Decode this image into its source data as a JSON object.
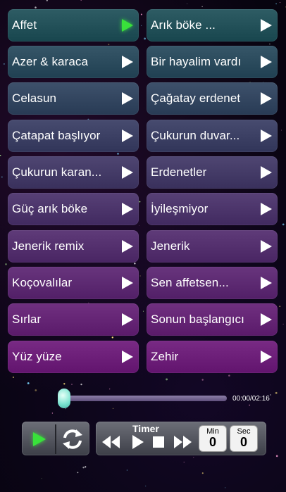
{
  "songs": [
    {
      "label": "Affet",
      "active": true
    },
    {
      "label": "Arık böke ...",
      "active": false
    },
    {
      "label": "Azer & karaca",
      "active": false
    },
    {
      "label": "Bir hayalim vardı",
      "active": false
    },
    {
      "label": "Celasun",
      "active": false
    },
    {
      "label": "Çağatay erdenet",
      "active": false
    },
    {
      "label": "Çatapat başlıyor",
      "active": false
    },
    {
      "label": "Çukurun duvar...",
      "active": false
    },
    {
      "label": "Çukurun karan...",
      "active": false
    },
    {
      "label": "Erdenetler",
      "active": false
    },
    {
      "label": "Güç arık böke",
      "active": false
    },
    {
      "label": "İyileşmiyor",
      "active": false
    },
    {
      "label": "Jenerik remix",
      "active": false
    },
    {
      "label": "Jenerik",
      "active": false
    },
    {
      "label": "Koçovalılar",
      "active": false
    },
    {
      "label": "Sen affetsen...",
      "active": false
    },
    {
      "label": "Sırlar",
      "active": false
    },
    {
      "label": "Sonun başlangıcı",
      "active": false
    },
    {
      "label": "Yüz yüze",
      "active": false
    },
    {
      "label": "Zehir",
      "active": false
    }
  ],
  "player": {
    "time_display": "00:00/02:16",
    "progress": 0,
    "accent_color": "#39e23b"
  },
  "timer": {
    "title": "Timer",
    "min_label": "Min",
    "min_value": "0",
    "sec_label": "Sec",
    "sec_value": "0"
  },
  "icons": {
    "main_play": "play-icon",
    "repeat": "repeat-icon",
    "rewind": "rewind-icon",
    "play": "play-icon",
    "stop": "stop-icon",
    "fast_forward": "fast-forward-icon"
  }
}
